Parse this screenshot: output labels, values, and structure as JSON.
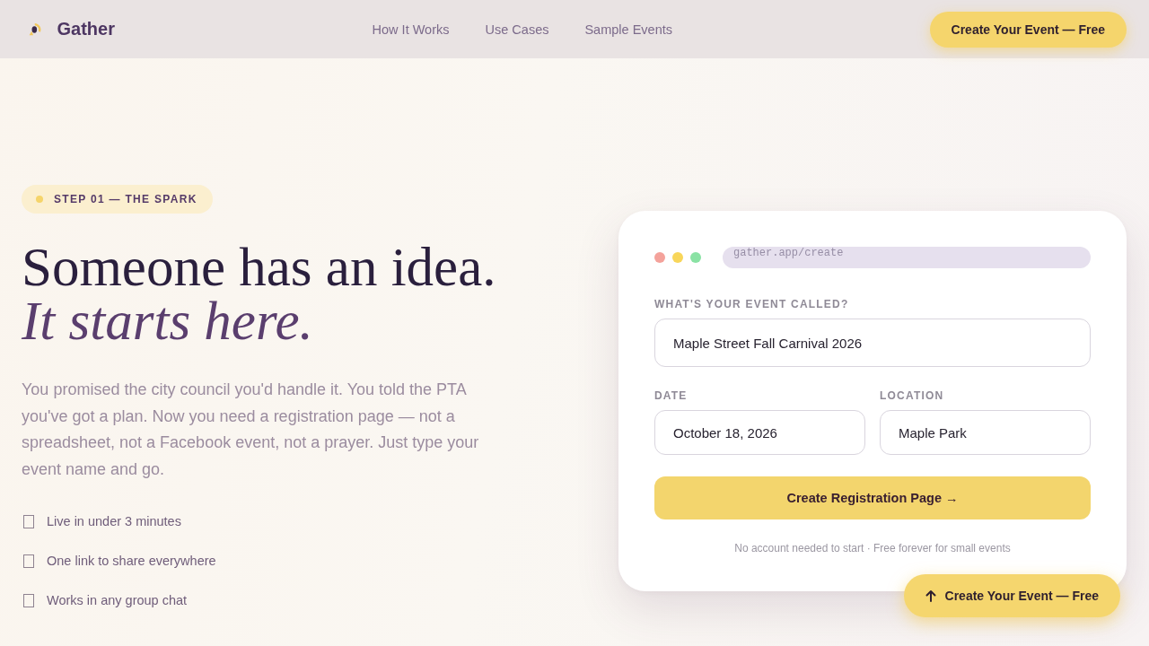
{
  "nav": {
    "brand": "Gather",
    "links": [
      "How It Works",
      "Use Cases",
      "Sample Events"
    ],
    "cta": "Create Your Event — Free"
  },
  "hero": {
    "badge": "STEP 01 — THE SPARK",
    "headline": "Someone has an idea.",
    "headline_accent": "It starts here.",
    "body": "You promised the city council you'd handle it. You told the PTA you've got a plan. Now you need a registration page — not a spreadsheet, not a Facebook event, not a prayer. Just type your event name and go.",
    "features": [
      "Live in under 3 minutes",
      "One link to share everywhere",
      "Works in any group chat"
    ]
  },
  "form_card": {
    "url": "gather.app/create",
    "fields": [
      {
        "label": "WHAT'S YOUR EVENT CALLED?",
        "value": "Maple Street Fall Carnival 2026"
      },
      {
        "label": "DATE",
        "value": "October 18, 2026"
      },
      {
        "label": "LOCATION",
        "value": "Maple Park"
      }
    ],
    "submit": "Create Registration Page →",
    "note": "No account needed to start · Free forever for small events"
  },
  "floating_cta": {
    "label": "Create Your Event — Free"
  }
}
